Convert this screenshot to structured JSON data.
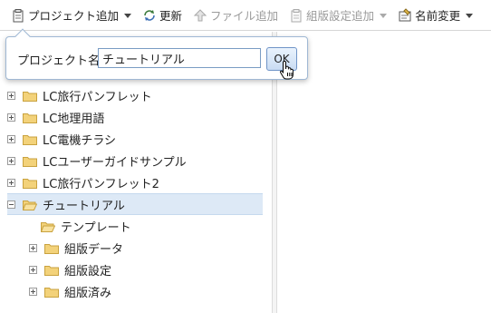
{
  "toolbar": {
    "add_project": "プロジェクト追加",
    "refresh": "更新",
    "add_file": "ファイル追加",
    "add_layout_setting": "組版設定追加",
    "rename": "名前変更"
  },
  "dialog": {
    "label": "プロジェクト名:",
    "input_value": "チュートリアル",
    "ok_label": "OK"
  },
  "tree": {
    "items": [
      {
        "label": "LC旅行パンフレット"
      },
      {
        "label": "LC地理用語"
      },
      {
        "label": "LC電機チラシ"
      },
      {
        "label": "LCユーザーガイドサンプル"
      },
      {
        "label": "LC旅行パンフレット2"
      },
      {
        "label": "チュートリアル"
      },
      {
        "label": "テンプレート"
      },
      {
        "label": "組版データ"
      },
      {
        "label": "組版設定"
      },
      {
        "label": "組版済み"
      }
    ]
  },
  "colors": {
    "selection": "#dde9f6",
    "folder": "#f3d27a",
    "folder_edge": "#c9a23f",
    "accent": "#6f94c7"
  }
}
